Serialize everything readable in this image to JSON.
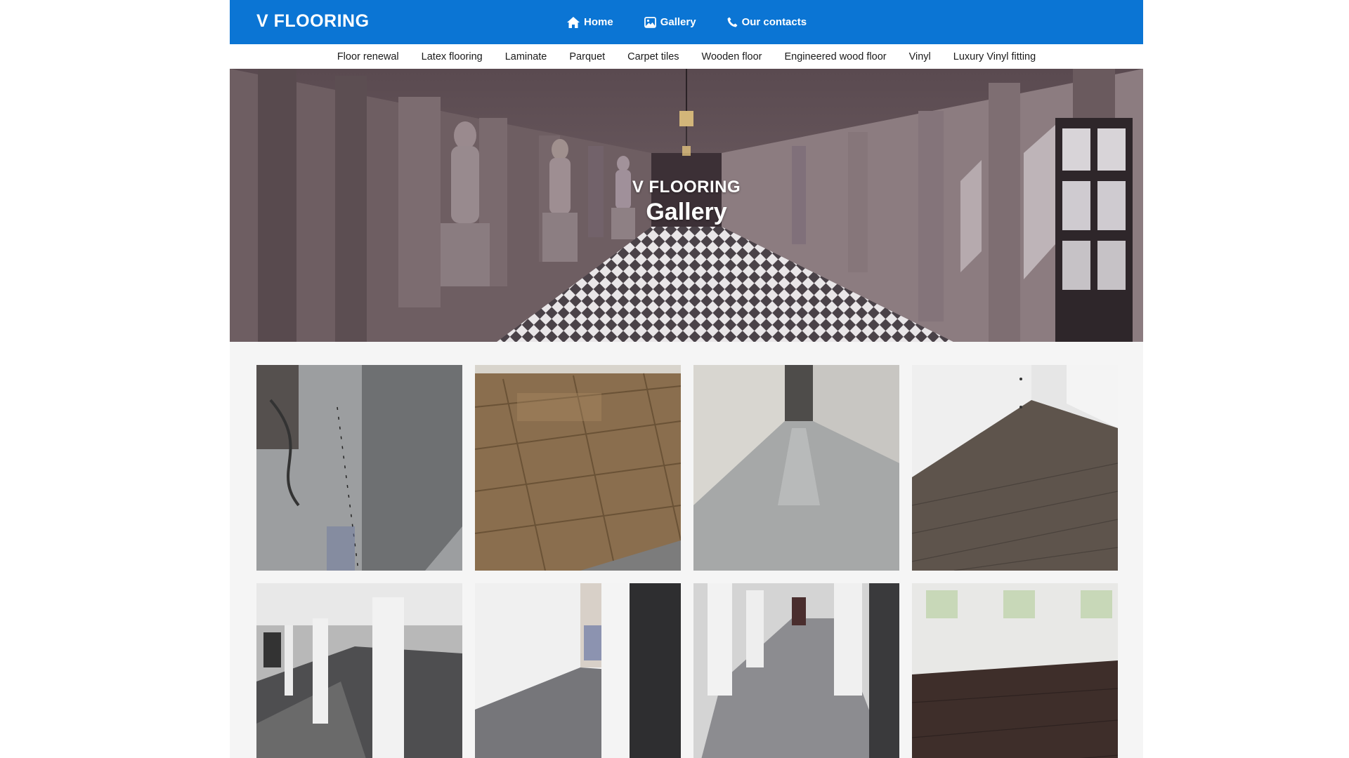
{
  "header": {
    "logo": "V FLOORING",
    "nav": [
      {
        "label": "Home",
        "icon": "home-icon"
      },
      {
        "label": "Gallery",
        "icon": "image-icon"
      },
      {
        "label": "Our contacts",
        "icon": "phone-icon"
      }
    ]
  },
  "categories": [
    "Floor renewal",
    "Latex flooring",
    "Laminate",
    "Parquet",
    "Carpet tiles",
    "Wooden floor",
    "Engineered wood floor",
    "Vinyl",
    "Luxury Vinyl fitting"
  ],
  "hero": {
    "brand": "V FLOORING",
    "title": "Gallery"
  },
  "colors": {
    "header_bg": "#0b75d4",
    "page_bg": "#f5f5f5",
    "nav_text": "#ffffff"
  }
}
